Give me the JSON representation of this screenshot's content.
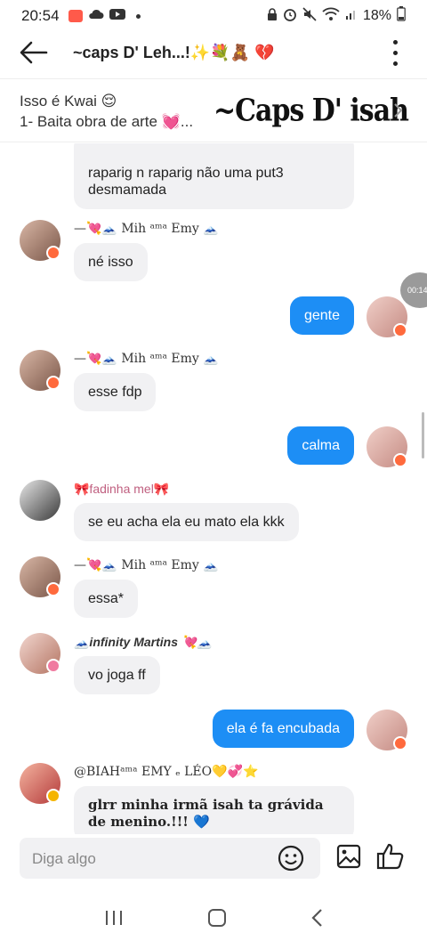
{
  "status": {
    "time": "20:54",
    "battery": "18%"
  },
  "header": {
    "title": "~caps D' Leh...!✨💐🧸 💔"
  },
  "pinned": {
    "line1": "Isso é Kwai 😌",
    "line2": "1- Baita obra de arte 💓...",
    "overlay": "~Caps D' isah"
  },
  "timer_chip": "00:14",
  "messages": [
    {
      "side": "left",
      "sender": "",
      "text": "raparig n raparig não uma put3 desmamada"
    },
    {
      "side": "left",
      "sender": "—💘🗻 Mih ᵃᵐᵃ Emy 🗻",
      "text": "né isso"
    },
    {
      "side": "right",
      "text": "gente"
    },
    {
      "side": "left",
      "sender": "—💘🗻 Mih ᵃᵐᵃ Emy 🗻",
      "text": "esse fdp"
    },
    {
      "side": "right",
      "text": "calma"
    },
    {
      "side": "left",
      "sender": "🎀fadinha mel🎀",
      "text": "se eu acha ela eu mato ela kkk"
    },
    {
      "side": "left",
      "sender": "—💘🗻 Mih ᵃᵐᵃ Emy 🗻",
      "text": "essa*"
    },
    {
      "side": "left",
      "sender": "🗻infinity Martins 💘🗻",
      "text": "vo joga ff"
    },
    {
      "side": "right",
      "text": "ela é fa encubada"
    },
    {
      "side": "left",
      "sender": "@BIAHᵃᵐᵃ EMY ₑ LÉO💛💞⭐",
      "text": "glrr minha irmã isah ta grávida de menino.!!! 💙"
    }
  ],
  "input": {
    "placeholder": "Diga algo"
  },
  "colors": {
    "accent": "#1d8ef5",
    "bubble_left": "#f1f1f3",
    "badge": "#ff6a3d"
  }
}
